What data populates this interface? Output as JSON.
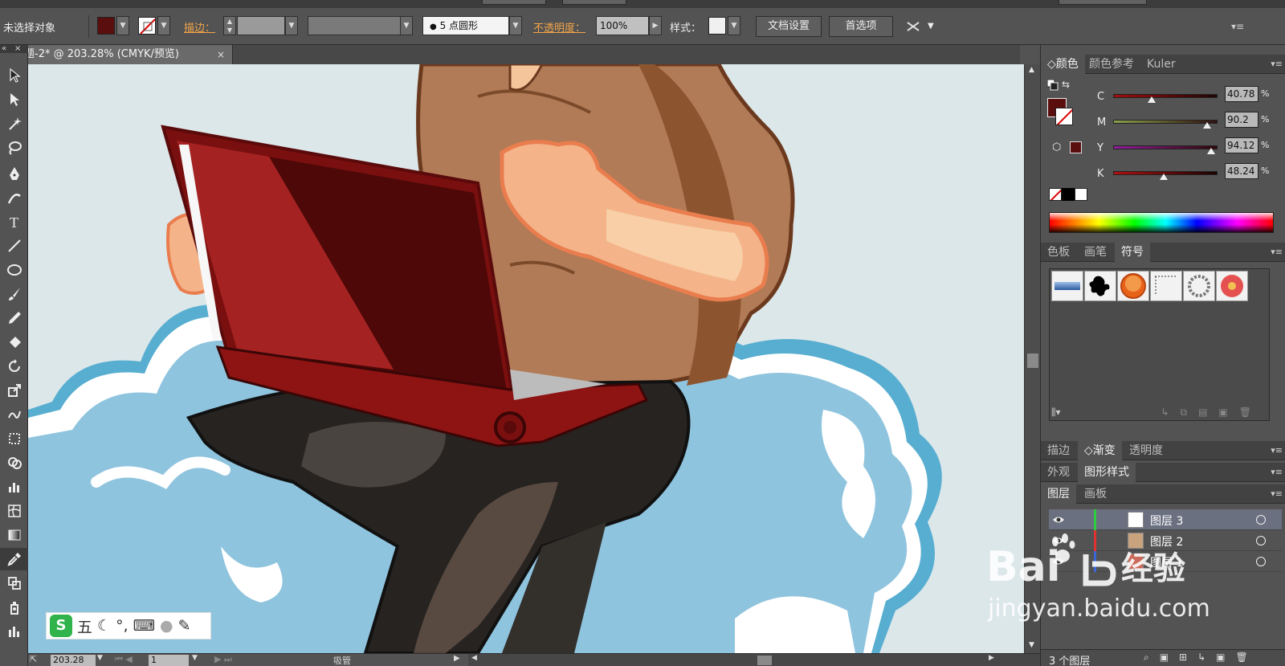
{
  "control_bar": {
    "selection_label": "未选择对象",
    "stroke_label": "描边：",
    "brush_field": "5 点圆形",
    "opacity_label": "不透明度：",
    "opacity_value": "100%",
    "style_label": "样式：",
    "doc_setup_button": "文档设置",
    "preferences_button": "首选项",
    "fill_color": "#5a0e0e"
  },
  "document_tab": {
    "title": "题-2* @ 203.28% (CMYK/预览)",
    "close": "×"
  },
  "status_bar": {
    "zoom": "203.28",
    "artboard": "1",
    "tool_name": "吸管"
  },
  "color_panel": {
    "tabs": [
      "颜色",
      "颜色参考",
      "Kuler"
    ],
    "channels": [
      {
        "label": "C",
        "value": "40.78",
        "fraction": 0.408,
        "color": "#c01010"
      },
      {
        "label": "M",
        "value": "90.2",
        "fraction": 0.902,
        "color": "#8aa04b"
      },
      {
        "label": "Y",
        "value": "94.12",
        "fraction": 0.941,
        "color": "#8f1e9a"
      },
      {
        "label": "K",
        "value": "48.24",
        "fraction": 0.482,
        "color": "#b01010"
      }
    ],
    "percent": "%"
  },
  "swatch_panel": {
    "tabs": [
      "色板",
      "画笔",
      "符号"
    ]
  },
  "appearance_panels": {
    "row1": [
      "描边",
      "渐变",
      "透明度"
    ],
    "row2": [
      "外观",
      "图形样式"
    ],
    "row3": [
      "图层",
      "画板"
    ]
  },
  "layers": {
    "items": [
      {
        "name": "图层 3"
      },
      {
        "name": "图层 2"
      },
      {
        "name": "图层 1"
      }
    ],
    "footer_count": "3 个图层"
  },
  "ime": {
    "mode_label": "五"
  },
  "watermark": {
    "brand": "Bai",
    "product": "经验",
    "url": "jingyan.baidu.com"
  }
}
